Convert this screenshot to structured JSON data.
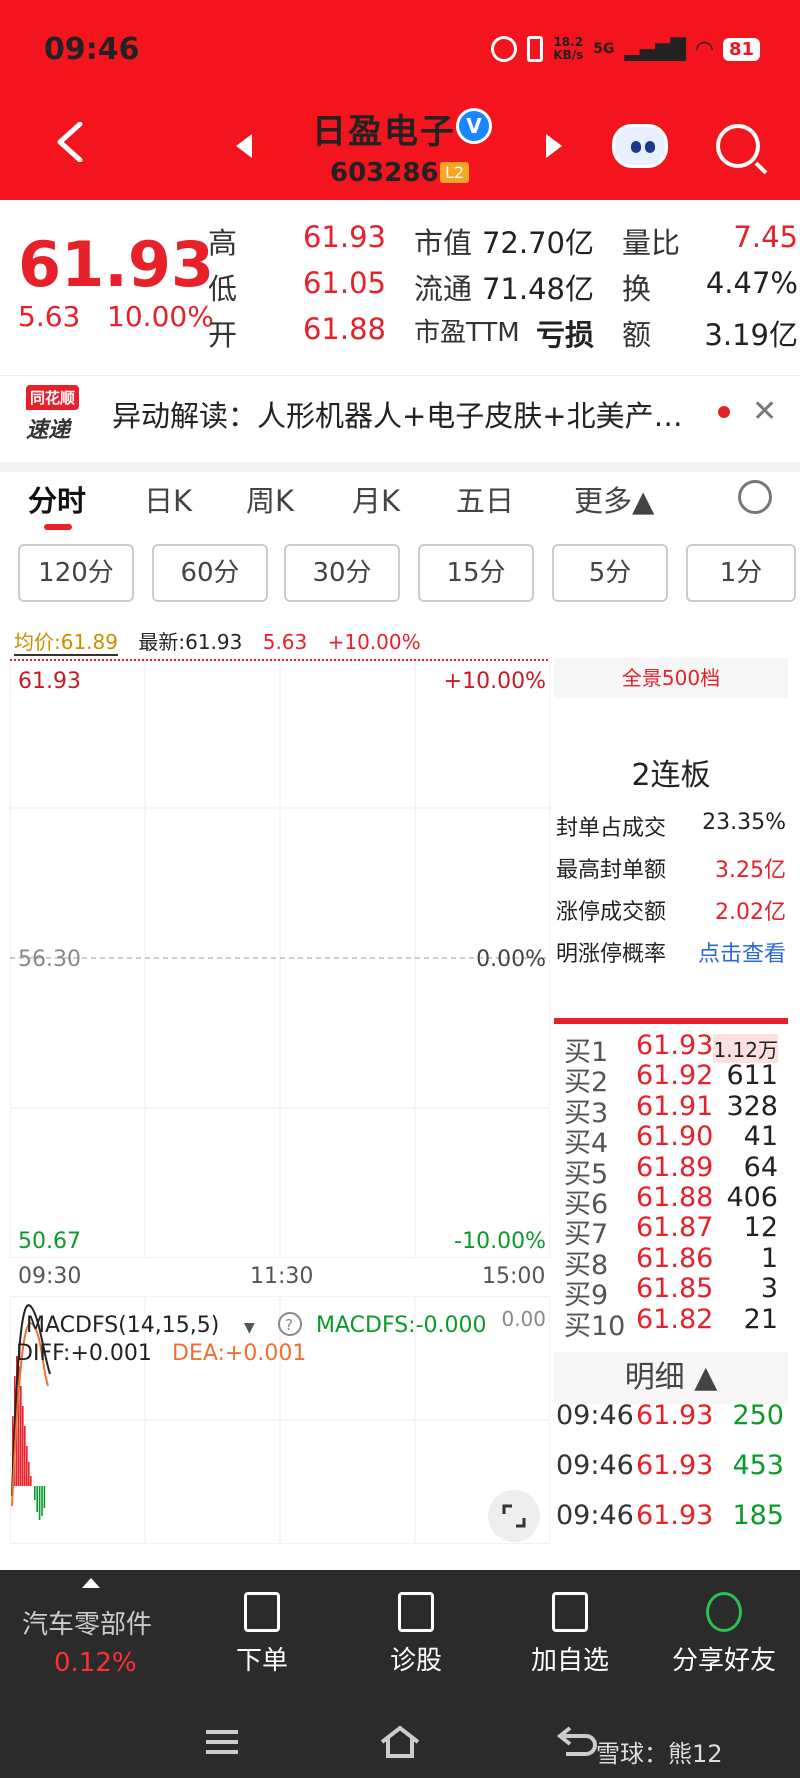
{
  "status": {
    "time": "09:46",
    "net_speed": "18.2\nKB/s",
    "network": "5G",
    "battery": "81"
  },
  "header": {
    "stock_name": "日盈电子",
    "stock_code": "603286",
    "level_badge": "L2",
    "verified_mark": "V"
  },
  "quote": {
    "price": "61.93",
    "change": "5.63",
    "change_pct": "10.00%",
    "high_label": "高",
    "high": "61.93",
    "low_label": "低",
    "low": "61.05",
    "open_label": "开",
    "open": "61.88",
    "mktcap_label": "市值",
    "mktcap": "72.70亿",
    "float_label": "流通",
    "float": "71.48亿",
    "pe_label": "市盈TTM",
    "pe": "亏损",
    "vol_ratio_label": "量比",
    "vol_ratio": "7.45",
    "turnover_label": "换",
    "turnover": "4.47%",
    "amount_label": "额",
    "amount": "3.19亿"
  },
  "news": {
    "logo_top": "同花顺",
    "logo_bottom": "速递",
    "text": "异动解读：人形机器人+电子皮肤+北美产…"
  },
  "tabs": [
    "分时",
    "日K",
    "周K",
    "月K",
    "五日",
    "更多▲"
  ],
  "periods": [
    "120分",
    "60分",
    "30分",
    "15分",
    "5分",
    "1分"
  ],
  "legend": {
    "avg": "均价:61.89",
    "last": "最新:61.93",
    "chg": "5.63",
    "pct": "+10.00%"
  },
  "chart": {
    "top_price": "61.93",
    "top_pct": "+10.00%",
    "mid_price": "56.30",
    "mid_pct": "0.00%",
    "bot_price": "50.67",
    "bot_pct": "-10.00%",
    "times": [
      "09:30",
      "11:30",
      "15:00"
    ],
    "macd_title": "MACDFS(14,15,5)",
    "macd_value": "MACDFS:-0.000",
    "diff": "DIFF:+0.001",
    "dea": "DEA:+0.001",
    "macd_zero": "0.00",
    "colors": {
      "up": "#e8202a",
      "down": "#0a9a2a",
      "avg": "#e8a000",
      "diff": "#222222",
      "dea": "#f07030"
    }
  },
  "panel": {
    "panorama": "全景500档",
    "lianban": "2连板",
    "stats": [
      {
        "label": "封单占成交",
        "value": "23.35%",
        "color": "dark"
      },
      {
        "label": "最高封单额",
        "value": "3.25亿",
        "color": "red"
      },
      {
        "label": "涨停成交额",
        "value": "2.02亿",
        "color": "red"
      },
      {
        "label": "明涨停概率",
        "value": "点击查看",
        "color": "blue"
      }
    ],
    "orderbook": [
      {
        "label": "买1",
        "price": "61.93",
        "vol": "1.12万"
      },
      {
        "label": "买2",
        "price": "61.92",
        "vol": "611"
      },
      {
        "label": "买3",
        "price": "61.91",
        "vol": "328"
      },
      {
        "label": "买4",
        "price": "61.90",
        "vol": "41"
      },
      {
        "label": "买5",
        "price": "61.89",
        "vol": "64"
      },
      {
        "label": "买6",
        "price": "61.88",
        "vol": "406"
      },
      {
        "label": "买7",
        "price": "61.87",
        "vol": "12"
      },
      {
        "label": "买8",
        "price": "61.86",
        "vol": "1"
      },
      {
        "label": "买9",
        "price": "61.85",
        "vol": "3"
      },
      {
        "label": "买10",
        "price": "61.82",
        "vol": "21"
      }
    ],
    "detail_header": "明细 ▲",
    "ticks": [
      {
        "time": "09:46",
        "price": "61.93",
        "vol": "250"
      },
      {
        "time": "09:46",
        "price": "61.93",
        "vol": "453"
      },
      {
        "time": "09:46",
        "price": "61.93",
        "vol": "185"
      }
    ]
  },
  "bottom": {
    "sector_name": "汽车零部件",
    "sector_chg": "0.12%",
    "order": "下单",
    "diagnose": "诊股",
    "add_watch": "加自选",
    "share": "分享好友"
  },
  "watermark": "雪球：熊12"
}
